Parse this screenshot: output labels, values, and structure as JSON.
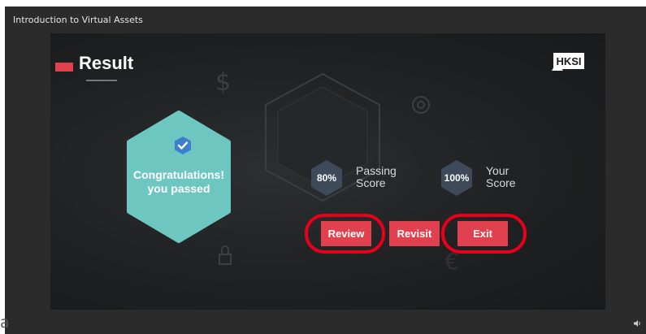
{
  "header": {
    "course_title": "Introduction to Virtual Assets"
  },
  "slide": {
    "title": "Result",
    "logo_text": "HKSI",
    "message_line1": "Congratulations!",
    "message_line2": "you passed",
    "passing": {
      "value": "80%",
      "caption_line1": "Passing",
      "caption_line2": "Score"
    },
    "your": {
      "value": "100%",
      "caption_line1": "Your",
      "caption_line2": "Score"
    }
  },
  "buttons": {
    "review": "Review",
    "revisit": "Revisit",
    "exit": "Exit"
  },
  "colors": {
    "accent": "#e1414f",
    "badge": "#6ec6c0",
    "highlight": "#e8001a",
    "hex_small": "#3e4a59"
  },
  "icons": {
    "check": "check-icon",
    "volume": "volume-icon"
  },
  "corner_text": "a"
}
